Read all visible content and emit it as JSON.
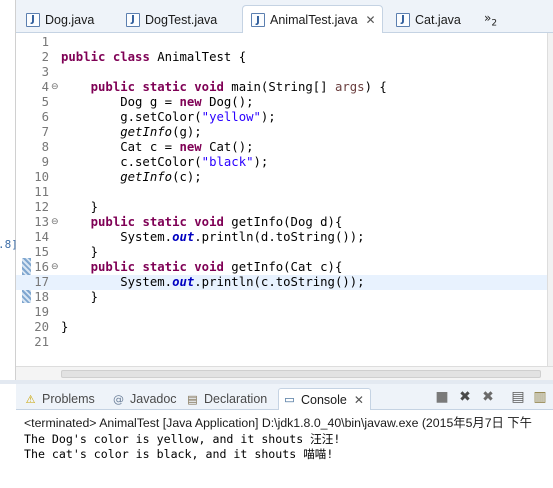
{
  "left_panel": {
    "fragment": ".8]"
  },
  "editor_tabs": [
    {
      "label": "Dog.java",
      "active": false
    },
    {
      "label": "DogTest.java",
      "active": false
    },
    {
      "label": "AnimalTest.java",
      "active": true
    },
    {
      "label": "Cat.java",
      "active": false
    }
  ],
  "tab_overflow": {
    "symbol": "»",
    "count": "2"
  },
  "close_glyph": "✕",
  "code_lines": [
    {
      "n": "1",
      "fold": "",
      "code": ""
    },
    {
      "n": "2",
      "fold": "",
      "code": "<span class=\"kw\">public</span> <span class=\"kw\">class</span> AnimalTest {"
    },
    {
      "n": "3",
      "fold": "",
      "code": ""
    },
    {
      "n": "4",
      "fold": "⊖",
      "code": "    <span class=\"kw\">public</span> <span class=\"kw\">static</span> <span class=\"kw\">void</span> main(String[] <span class=\"param\">args</span>) {"
    },
    {
      "n": "5",
      "fold": "",
      "code": "        Dog g = <span class=\"kw\">new</span> Dog();"
    },
    {
      "n": "6",
      "fold": "",
      "code": "        g.setColor(<span class=\"str\">\"yellow\"</span>);"
    },
    {
      "n": "7",
      "fold": "",
      "code": "        <span class=\"it\">getInfo</span>(g);"
    },
    {
      "n": "8",
      "fold": "",
      "code": "        Cat c = <span class=\"kw\">new</span> Cat();"
    },
    {
      "n": "9",
      "fold": "",
      "code": "        c.setColor(<span class=\"str\">\"black\"</span>);"
    },
    {
      "n": "10",
      "fold": "",
      "code": "        <span class=\"it\">getInfo</span>(c);"
    },
    {
      "n": "11",
      "fold": "",
      "code": ""
    },
    {
      "n": "12",
      "fold": "",
      "code": "    }"
    },
    {
      "n": "13",
      "fold": "⊖",
      "code": "    <span class=\"kw\">public</span> <span class=\"kw\">static</span> <span class=\"kw\">void</span> getInfo(Dog d){"
    },
    {
      "n": "14",
      "fold": "",
      "code": "        System.<span class=\"static-field\">out</span>.println(d.toString());"
    },
    {
      "n": "15",
      "fold": "",
      "code": "    }"
    },
    {
      "n": "16",
      "fold": "⊖",
      "code": "    <span class=\"kw\">public</span> <span class=\"kw\">static</span> <span class=\"kw\">void</span> getInfo(Cat c){"
    },
    {
      "n": "17",
      "fold": "",
      "code": "        System.<span class=\"static-field\">out</span>.println(c.toString());",
      "current": true
    },
    {
      "n": "18",
      "fold": "",
      "code": "    }"
    },
    {
      "n": "19",
      "fold": "",
      "code": ""
    },
    {
      "n": "20",
      "fold": "",
      "code": "}"
    },
    {
      "n": "21",
      "fold": "",
      "code": ""
    }
  ],
  "panel_tabs": [
    {
      "label": "Problems",
      "icon": "problems-icon",
      "glyph": "⚠",
      "active": false
    },
    {
      "label": "Javadoc",
      "icon": "javadoc-icon",
      "glyph": "@",
      "active": false
    },
    {
      "label": "Declaration",
      "icon": "declaration-icon",
      "glyph": "▤",
      "active": false
    },
    {
      "label": "Console",
      "icon": "console-icon",
      "glyph": "▭",
      "active": true
    }
  ],
  "console": {
    "status": "<terminated> AnimalTest [Java Application] D:\\jdk1.8.0_40\\bin\\javaw.exe (2015年5月7日 下午",
    "lines": [
      "The Dog's color is yellow, and it shouts 汪汪!",
      "The cat's color is black, and it shouts 喵喵!"
    ]
  },
  "colors": {
    "keyword": "#7f0055",
    "string": "#2a00ff",
    "static_field": "#0000c0",
    "current_line": "#e8f2fe"
  }
}
